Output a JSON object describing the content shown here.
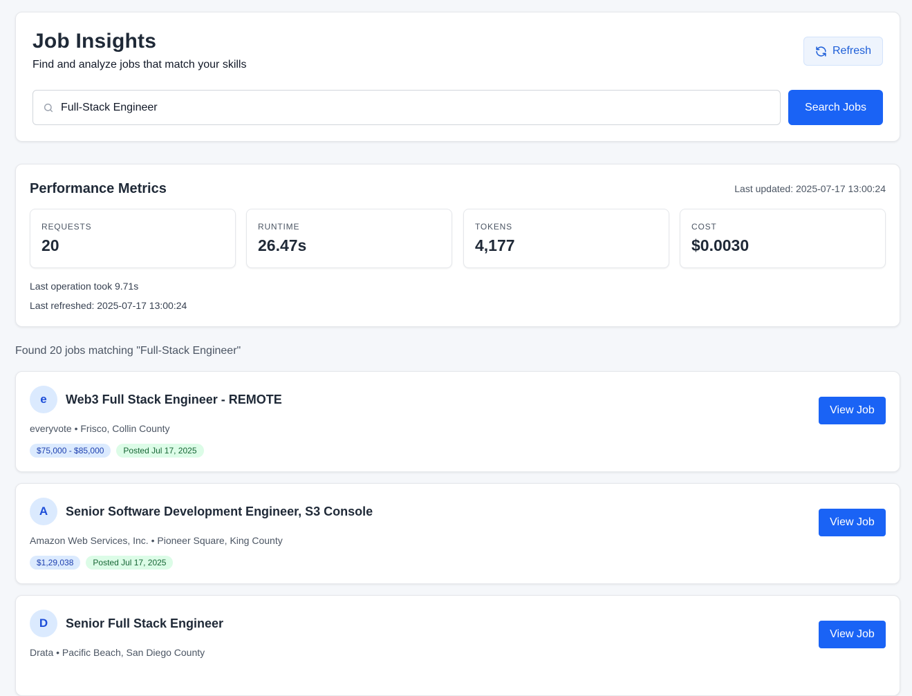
{
  "header": {
    "title": "Job Insights",
    "subtitle": "Find and analyze jobs that match your skills",
    "refresh_label": "Refresh",
    "search_value": "Full-Stack Engineer",
    "search_button_label": "Search Jobs"
  },
  "metrics": {
    "title": "Performance Metrics",
    "last_updated": "Last updated: 2025-07-17 13:00:24",
    "items": [
      {
        "label": "REQUESTS",
        "value": "20"
      },
      {
        "label": "RUNTIME",
        "value": "26.47s"
      },
      {
        "label": "TOKENS",
        "value": "4,177"
      },
      {
        "label": "COST",
        "value": "$0.0030"
      }
    ],
    "last_operation": "Last operation took 9.71s",
    "last_refreshed": "Last refreshed: 2025-07-17 13:00:24"
  },
  "results": {
    "summary": "Found 20 jobs matching \"Full-Stack Engineer\"",
    "view_label": "View Job",
    "jobs": [
      {
        "initial": "e",
        "title": "Web3 Full Stack Engineer - REMOTE",
        "meta": "everyvote • Frisco, Collin County",
        "salary": "$75,000 - $85,000",
        "posted": "Posted Jul 17, 2025"
      },
      {
        "initial": "A",
        "title": "Senior Software Development Engineer, S3 Console",
        "meta": "Amazon Web Services, Inc. • Pioneer Square, King County",
        "salary": "$1,29,038",
        "posted": "Posted Jul 17, 2025"
      },
      {
        "initial": "D",
        "title": "Senior Full Stack Engineer",
        "meta": "Drata • Pacific Beach, San Diego County",
        "salary": "",
        "posted": ""
      }
    ]
  },
  "colors": {
    "accent": "#1a63f5",
    "salary_tag": "#dbeafe",
    "posted_tag": "#dcfce7"
  },
  "icons": {
    "refresh": "refresh-icon",
    "search": "search-icon"
  }
}
